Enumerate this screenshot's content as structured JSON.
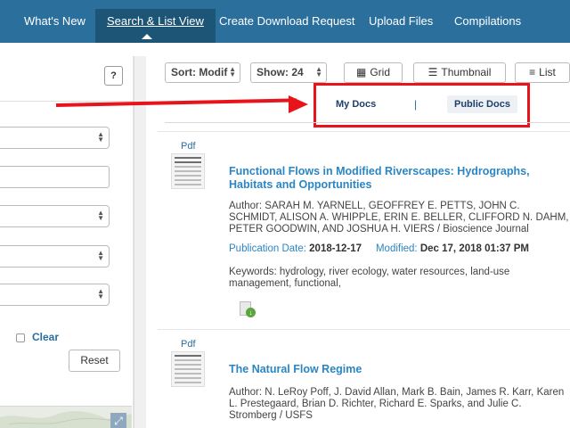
{
  "nav": {
    "items": [
      {
        "label": "What's New"
      },
      {
        "label": "Search & List View",
        "active": true
      },
      {
        "label": "Create Download Request"
      },
      {
        "label": "Upload Files"
      },
      {
        "label": "Compilations"
      }
    ]
  },
  "left_panel": {
    "help_label": "?",
    "clear_label": "Clear",
    "reset_label": "Reset"
  },
  "toolbar": {
    "sort_label": "Sort: Modif",
    "show_label": "Show: 24",
    "views": [
      {
        "label": "Grid",
        "icon": "grid-icon"
      },
      {
        "label": "Thumbnail",
        "icon": "thumbnail-icon"
      },
      {
        "label": "List",
        "icon": "list-icon"
      }
    ]
  },
  "doc_tabs": {
    "my_docs": "My Docs",
    "separator": "|",
    "public_docs": "Public Docs"
  },
  "annotation": {
    "color": "#e8141b"
  },
  "results": [
    {
      "type": "Pdf",
      "title": "Functional Flows in Modified Riverscapes: Hydrographs, Habitats and Opportunities",
      "author": "Author: SARAH M. YARNELL, GEOFFREY E. PETTS, JOHN C. SCHMIDT, ALISON A. WHIPPLE, ERIN E. BELLER, CLIFFORD N. DAHM, PETER GOODWIN, AND JOSHUA H. VIERS / Bioscience Journal",
      "publication_label": "Publication Date:",
      "publication_date": "2018-12-17",
      "modified_label": "Modified:",
      "modified_date": "Dec 17, 2018 01:37 PM",
      "keywords": "Keywords: hydrology, river ecology, water resources, land-use management, functional,"
    },
    {
      "type": "Pdf",
      "title": "The Natural Flow Regime",
      "author": "Author: N. LeRoy Poff, J. David Allan, Mark B. Bain, James R. Karr, Karen L. Prestegaard, Brian D. Richter, Richard E. Sparks, and Julie C. Stromberg / USFS"
    }
  ],
  "colors": {
    "nav_bg": "#2b6f9d",
    "nav_active": "#1d5577",
    "link": "#2a86c4",
    "accent_red": "#e8141b"
  }
}
